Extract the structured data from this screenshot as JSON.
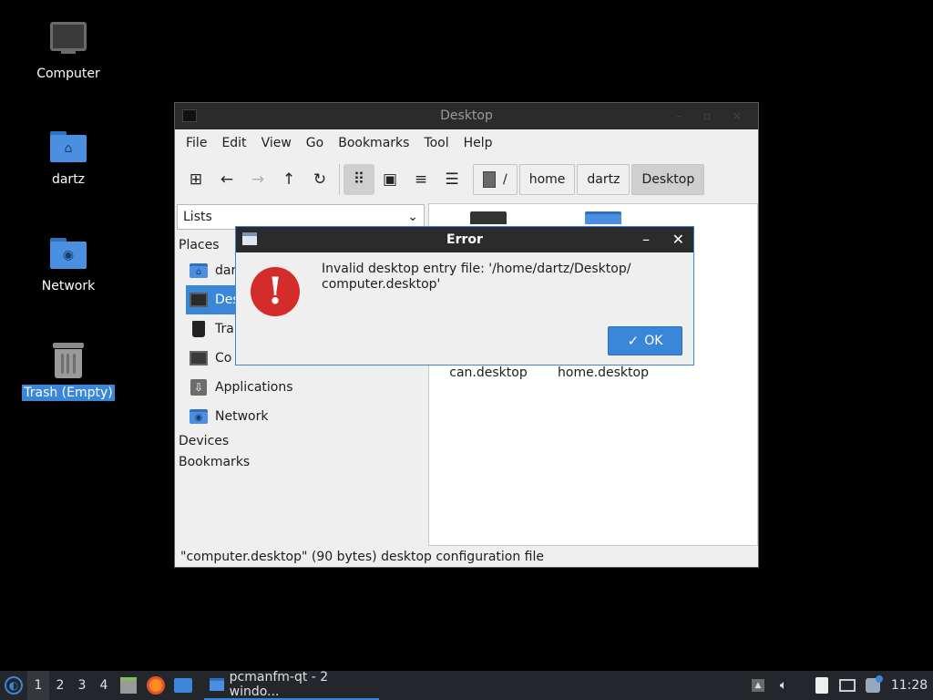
{
  "desktop": {
    "icons": [
      {
        "label": "Computer"
      },
      {
        "label": "dartz"
      },
      {
        "label": "Network"
      },
      {
        "label": "Trash (Empty)"
      }
    ]
  },
  "file_manager": {
    "title": "Desktop",
    "menu": [
      "File",
      "Edit",
      "View",
      "Go",
      "Bookmarks",
      "Tool",
      "Help"
    ],
    "breadcrumbs": [
      "/",
      "home",
      "dartz",
      "Desktop"
    ],
    "view_mode": "Lists",
    "side_headings": {
      "places": "Places",
      "devices": "Devices",
      "bookmarks": "Bookmarks"
    },
    "places": [
      {
        "label": "dartz",
        "icon": "home-folder-icon"
      },
      {
        "label": "Desktop",
        "icon": "desktop-icon"
      },
      {
        "label": "Trash",
        "icon": "trash-icon"
      },
      {
        "label": "Computer",
        "icon": "computer-icon"
      },
      {
        "label": "Applications",
        "icon": "applications-icon"
      },
      {
        "label": "Network",
        "icon": "network-folder-icon"
      }
    ],
    "places_visible": [
      "dar",
      "Des",
      "Tra",
      "Co",
      "Applications",
      "Network"
    ],
    "files": [
      {
        "name": "can.desktop"
      },
      {
        "name": "home.desktop"
      }
    ],
    "status_text": "\"computer.desktop\" (90 bytes) desktop configuration file"
  },
  "error_dialog": {
    "title": "Error",
    "message": "Invalid desktop entry file: '/home/dartz/Desktop/ computer.desktop'",
    "ok_label": "OK",
    "accent": "#3a86d8",
    "error_color": "#d42b2b"
  },
  "taskbar": {
    "workspaces": [
      "1",
      "2",
      "3",
      "4"
    ],
    "active_workspace": "1",
    "task_label": "pcmanfm-qt - 2 windo...",
    "clock": "11:28"
  }
}
